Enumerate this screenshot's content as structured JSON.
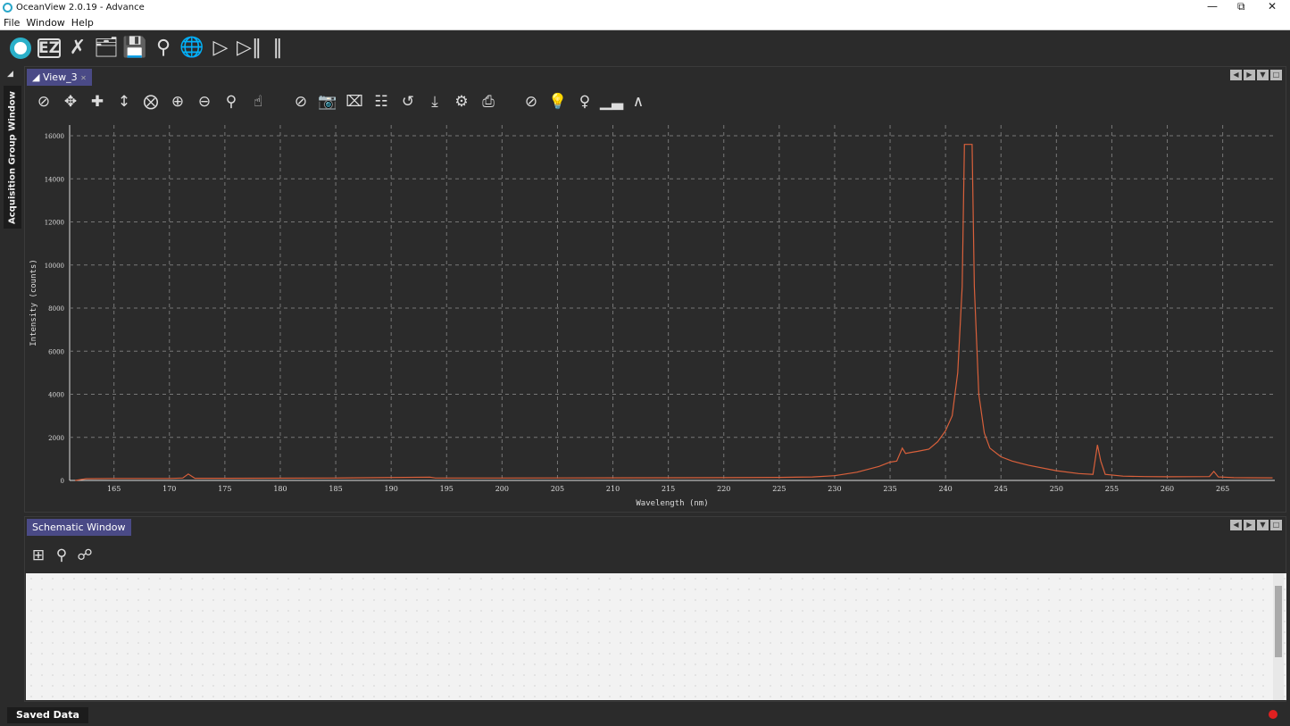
{
  "window": {
    "title": "OceanView 2.0.19  - Advance",
    "controls": [
      "minimize",
      "restore",
      "close"
    ]
  },
  "menu": [
    "File",
    "Window",
    "Help"
  ],
  "main_toolbar": [
    {
      "name": "oceanview-logo-icon"
    },
    {
      "name": "ez-icon",
      "label": "EZ"
    },
    {
      "name": "tools-icon"
    },
    {
      "name": "open-folder-icon"
    },
    {
      "name": "save-icon"
    },
    {
      "name": "search-icon"
    },
    {
      "name": "globe-icon"
    },
    {
      "name": "play-icon"
    },
    {
      "name": "step-icon"
    },
    {
      "name": "pause-icon"
    }
  ],
  "side_tab": "Acquisition Group Window",
  "view_panel": {
    "tab": "View_3",
    "toolbar": [
      "autoscale-icon",
      "pan-icon",
      "crosshair-icon",
      "vertical-scale-icon",
      "zoom-2-icon",
      "zoom-in-icon",
      "zoom-out-icon",
      "zoom-icon",
      "hand-icon",
      "autoscale-alt-icon",
      "camera-icon",
      "clear-icon",
      "overlay-icon",
      "refresh-icon",
      "export-icon",
      "settings-icon",
      "print-icon",
      "reset-view-icon",
      "lightbulb-on-icon",
      "lightbulb-off-icon",
      "chart-icon",
      "peak-icon"
    ]
  },
  "chart_data": {
    "type": "line",
    "xlabel": "Wavelength (nm)",
    "ylabel": "Intensity (counts)",
    "xlim": [
      161,
      269.7
    ],
    "ylim": [
      0,
      16500
    ],
    "xticks": [
      165,
      170,
      175,
      180,
      185,
      190,
      195,
      200,
      205,
      210,
      215,
      220,
      225,
      230,
      235,
      240,
      245,
      250,
      255,
      260,
      265
    ],
    "yticks": [
      0,
      2000,
      4000,
      6000,
      8000,
      10000,
      12000,
      14000,
      16000
    ],
    "grid": true,
    "color": "#d9603b",
    "series": [
      {
        "x": [
          161.5,
          162.5,
          165,
          170,
          171.2,
          171.7,
          172.3,
          175,
          185,
          193.5,
          194,
          200,
          210,
          220,
          225,
          228,
          230,
          232,
          234,
          235,
          235.6,
          236.1,
          236.4,
          236.9,
          237.5,
          238.5,
          239.3,
          240,
          240.6,
          241.1,
          241.5,
          241.7,
          242.4,
          242.6,
          243,
          243.5,
          244,
          245,
          246,
          247.5,
          250,
          252,
          253.3,
          253.7,
          254,
          254.4,
          256,
          258,
          260,
          263.8,
          264.2,
          264.6,
          266,
          269.5
        ],
        "y": [
          0,
          80,
          90,
          90,
          110,
          300,
          100,
          100,
          110,
          150,
          110,
          110,
          120,
          130,
          140,
          160,
          220,
          380,
          650,
          850,
          900,
          1500,
          1250,
          1300,
          1350,
          1450,
          1800,
          2300,
          3000,
          5000,
          9000,
          15600,
          15600,
          9000,
          4000,
          2200,
          1500,
          1100,
          900,
          700,
          450,
          320,
          280,
          1650,
          900,
          280,
          200,
          180,
          170,
          180,
          420,
          160,
          130,
          120
        ]
      }
    ]
  },
  "schematic_panel": {
    "tab": "Schematic Window",
    "toolbar": [
      "layout-icon",
      "search-icon",
      "connect-icon"
    ]
  },
  "status": {
    "saved_data": "Saved Data",
    "recording_color": "#e02020"
  }
}
